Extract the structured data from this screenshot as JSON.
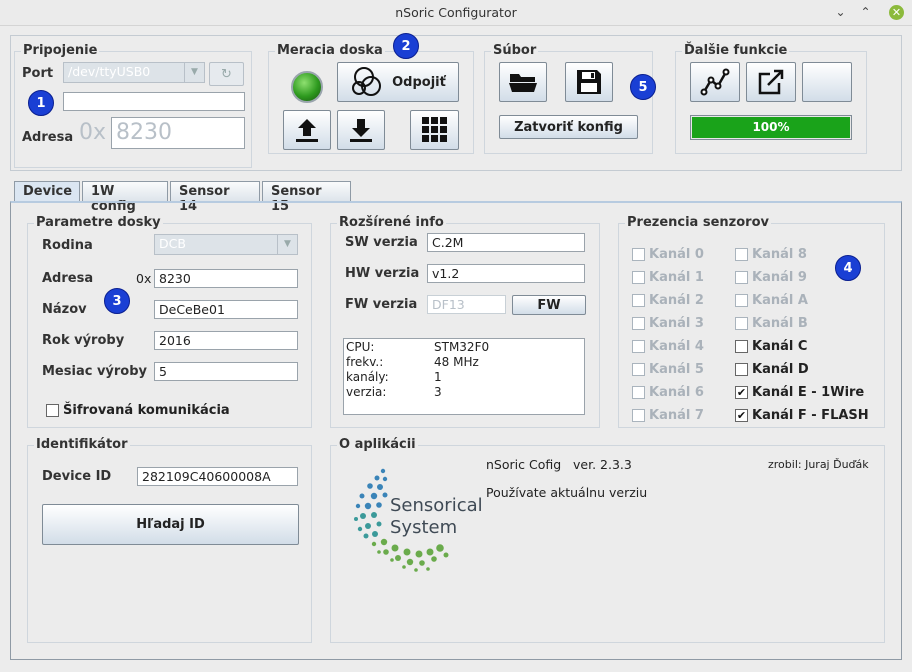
{
  "window": {
    "title": "nSoric Configurator"
  },
  "badges": [
    "1",
    "2",
    "3",
    "4",
    "5"
  ],
  "connection": {
    "title": "Pripojenie",
    "port_label": "Port",
    "port_value": "/dev/ttyUSB0",
    "address_label": "Adresa",
    "address_prefix": "0x",
    "address_value": "8230"
  },
  "board": {
    "title": "Meracia doska",
    "disconnect_label": "Odpojiť"
  },
  "file": {
    "title": "Súbor",
    "close_label": "Zatvoriť konfig"
  },
  "more": {
    "title": "Ďalšie funkcie",
    "progress_label": "100%",
    "progress": 1.0
  },
  "tabs": [
    "Device",
    "1W config",
    "Sensor 14",
    "Sensor 15"
  ],
  "params": {
    "title": "Parametre dosky",
    "family_label": "Rodina",
    "family_value": "DCB",
    "address_label": "Adresa",
    "address_prefix": "0x",
    "address_value": "8230",
    "name_label": "Názov",
    "name_value": "DeCeBe01",
    "year_label": "Rok výroby",
    "year_value": "2016",
    "month_label": "Mesiac výroby",
    "month_value": "5",
    "encrypt_label": "Šifrovaná komunikácia"
  },
  "ext": {
    "title": "Rozšírené info",
    "sw_label": "SW verzia",
    "sw_value": "C.2M",
    "hw_label": "HW verzia",
    "hw_value": "v1.2",
    "fw_label": "FW verzia",
    "fw_value": "DF13",
    "fw_button": "FW",
    "rows": [
      {
        "k": "CPU:",
        "v": "STM32F0"
      },
      {
        "k": "frekv.:",
        "v": "48 MHz"
      },
      {
        "k": "kanály:",
        "v": "1"
      },
      {
        "k": "verzia:",
        "v": "3"
      }
    ]
  },
  "sensors": {
    "title": "Prezencia senzorov",
    "channels": [
      {
        "label": "Kanál 0",
        "checked": false,
        "enabled": false
      },
      {
        "label": "Kanál 1",
        "checked": false,
        "enabled": false
      },
      {
        "label": "Kanál 2",
        "checked": false,
        "enabled": false
      },
      {
        "label": "Kanál 3",
        "checked": false,
        "enabled": false
      },
      {
        "label": "Kanál 4",
        "checked": false,
        "enabled": false
      },
      {
        "label": "Kanál 5",
        "checked": false,
        "enabled": false
      },
      {
        "label": "Kanál 6",
        "checked": false,
        "enabled": false
      },
      {
        "label": "Kanál 7",
        "checked": false,
        "enabled": false
      },
      {
        "label": "Kanál 8",
        "checked": false,
        "enabled": false
      },
      {
        "label": "Kanál 9",
        "checked": false,
        "enabled": false
      },
      {
        "label": "Kanál A",
        "checked": false,
        "enabled": false
      },
      {
        "label": "Kanál B",
        "checked": false,
        "enabled": false
      },
      {
        "label": "Kanál C",
        "checked": false,
        "enabled": true
      },
      {
        "label": "Kanál D",
        "checked": false,
        "enabled": true
      },
      {
        "label": "Kanál E - 1Wire",
        "checked": true,
        "enabled": true
      },
      {
        "label": "Kanál F - FLASH",
        "checked": true,
        "enabled": true
      }
    ]
  },
  "ident": {
    "title": "Identifikátor",
    "device_label": "Device ID",
    "device_value": "282109C40600008A",
    "find_label": "Hľadaj ID"
  },
  "about": {
    "title": "O aplikácii",
    "app": "nSoric Cofig",
    "version": "ver. 2.3.3",
    "author": "zrobil: Juraj Ďuďák",
    "status": "Používate aktuálnu verziu",
    "logo_line1": "Sensorical",
    "logo_line2": "System"
  },
  "colors": {
    "progress": "#1aa31a",
    "badge": "#1a3fd4",
    "led": "#2e9a1f"
  }
}
